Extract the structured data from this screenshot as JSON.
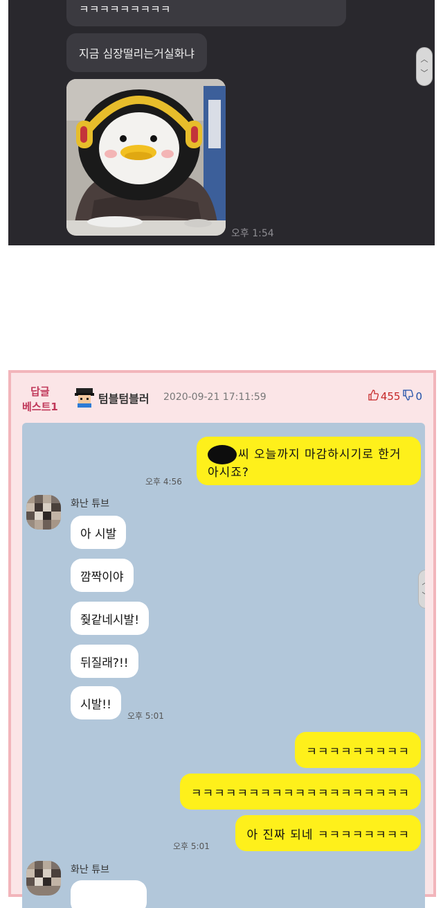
{
  "dark_chat": {
    "bubble_1": "ㅋㅋㅋㅋㅋㅋㅋㅋㅋ",
    "bubble_2": "지금 심장떨리는거실화냐",
    "sticker": "penguin-emoticon",
    "time": "오후 1:54"
  },
  "comment": {
    "badge_line1": "답글",
    "badge_line2": "베스트1",
    "username": "텀블텀블러",
    "date": "2020-09-21 17:11:59",
    "upvotes": "455",
    "downvotes": "0",
    "up_icon": "thumbs-up-icon",
    "down_icon": "thumbs-down-icon"
  },
  "kakao": {
    "colors": {
      "bg": "#b2c7da",
      "my_bubble": "#fef01b",
      "their_bubble": "#ffffff"
    },
    "sent_1": "씨 오늘까지 마감하시기로 한거",
    "sent_1b": "아시죠?",
    "sent_1_time": "오후 4:56",
    "friend_name": "화난 튜브",
    "received": [
      "아 시발",
      "깜짝이야",
      "줮같네시발!",
      "뒤질래?!!",
      "시발!!"
    ],
    "received_time": "오후 5:01",
    "sent_2": [
      "ㅋㅋㅋㅋㅋㅋㅋㅋㅋ",
      "ㅋㅋㅋㅋㅋㅋㅋㅋㅋㅋㅋㅋㅋㅋㅋㅋㅋㅋㅋ",
      "아 진짜 되네 ㅋㅋㅋㅋㅋㅋㅋㅋ"
    ],
    "sent_2_time": "오후 5:01",
    "friend_name_2": "화난 튜브"
  }
}
